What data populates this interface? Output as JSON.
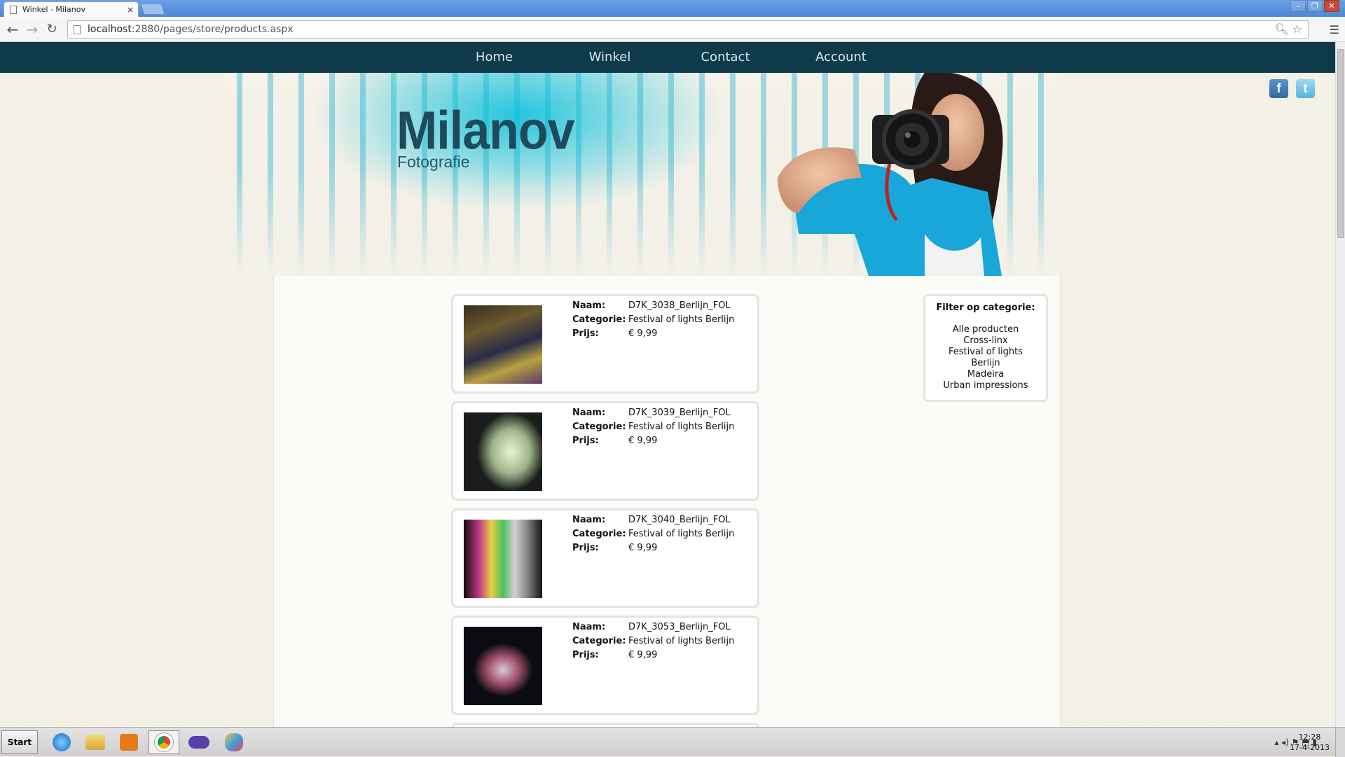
{
  "browser": {
    "tab_title": "Winkel - Milanov",
    "tab_close": "×",
    "url_host": "localhost",
    "url_rest": ":2880/pages/store/products.aspx",
    "window_controls": [
      "–",
      "❐",
      "✕"
    ]
  },
  "nav": {
    "items": [
      "Home",
      "Winkel",
      "Contact",
      "Account"
    ]
  },
  "header": {
    "logo": "Milanov",
    "tagline": "Fotografie"
  },
  "social": {
    "facebook": "f",
    "twitter": "t"
  },
  "products": [
    {
      "naam_label": "Naam:",
      "naam": "D7K_3038_Berlijn_FOL",
      "cat_label": "Categorie:",
      "categorie": "Festival of lights Berlijn",
      "prijs_label": "Prijs:",
      "prijs": "€ 9,99"
    },
    {
      "naam_label": "Naam:",
      "naam": "D7K_3039_Berlijn_FOL",
      "cat_label": "Categorie:",
      "categorie": "Festival of lights Berlijn",
      "prijs_label": "Prijs:",
      "prijs": "€ 9,99"
    },
    {
      "naam_label": "Naam:",
      "naam": "D7K_3040_Berlijn_FOL",
      "cat_label": "Categorie:",
      "categorie": "Festival of lights Berlijn",
      "prijs_label": "Prijs:",
      "prijs": "€ 9,99"
    },
    {
      "naam_label": "Naam:",
      "naam": "D7K_3053_Berlijn_FOL",
      "cat_label": "Categorie:",
      "categorie": "Festival of lights Berlijn",
      "prijs_label": "Prijs:",
      "prijs": "€ 9,99"
    }
  ],
  "filter": {
    "heading": "Filter op categorie:",
    "items": [
      "Alle producten",
      "Cross-linx",
      "Festival of lights",
      "Berlijn",
      "Madeira",
      "Urban impressions"
    ]
  },
  "taskbar": {
    "start": "Start",
    "time": "12:28",
    "date": "17-4-2013"
  },
  "colors": {
    "nav_bg": "#0e3a4c",
    "logo": "#1d4a5c",
    "accent_cyan": "#00bedc"
  }
}
